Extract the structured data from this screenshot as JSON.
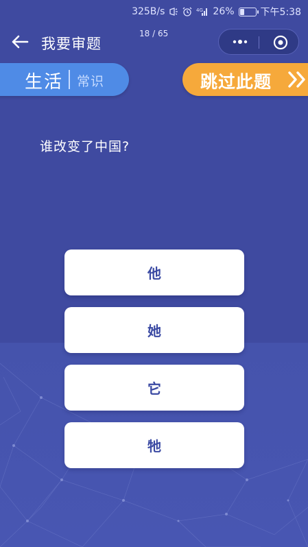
{
  "status_bar": {
    "speed": "325B/s",
    "signal": "4G",
    "battery": "26%",
    "battery_level": 0.26,
    "time": "下午5:38"
  },
  "header": {
    "title": "我要审题",
    "progress": "18 / 65"
  },
  "category": {
    "main": "生活",
    "sub": "常识"
  },
  "skip": {
    "label": "跳过此题"
  },
  "question": "谁改变了中国?",
  "answers": [
    "他",
    "她",
    "它",
    "牠"
  ],
  "colors": {
    "background": "#3f4aa0",
    "category": "#4f8be6",
    "skip": "#f6a93b",
    "answer_text": "#3b4aa3"
  }
}
